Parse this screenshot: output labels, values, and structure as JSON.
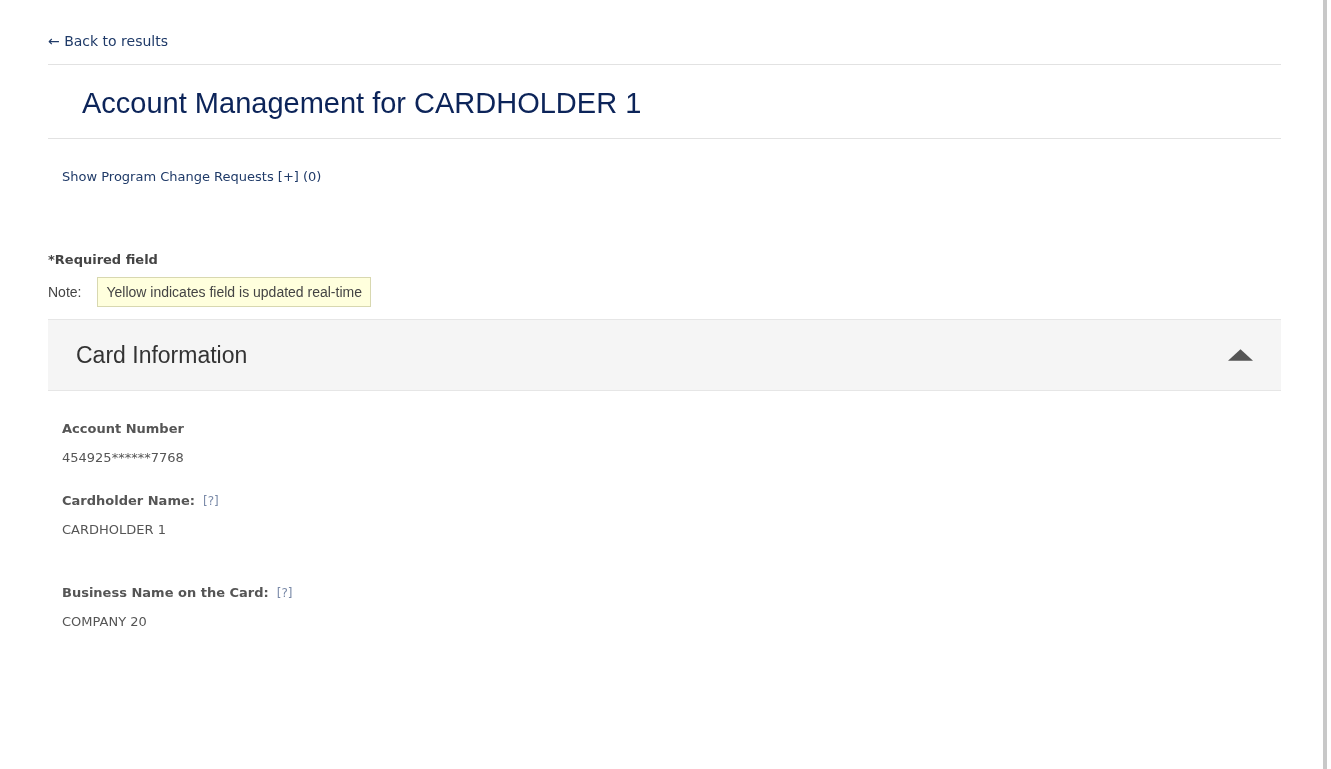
{
  "back_link": "← Back to results",
  "title": "Account Management for CARDHOLDER 1",
  "program_change_link": "Show Program Change Requests [+] (0)",
  "required_note": "*Required field",
  "note": {
    "label": "Note:",
    "text": "Yellow indicates field is updated real-time"
  },
  "section": {
    "title": "Card Information",
    "expanded": true,
    "fields": [
      {
        "label": "Account Number",
        "value": "454925******7768"
      },
      {
        "label": "Cardholder Name:",
        "help": "[?]",
        "value": "CARDHOLDER 1"
      },
      {
        "label": "Business Name on the Card:",
        "help": "[?]",
        "value": "COMPANY 20"
      }
    ]
  }
}
